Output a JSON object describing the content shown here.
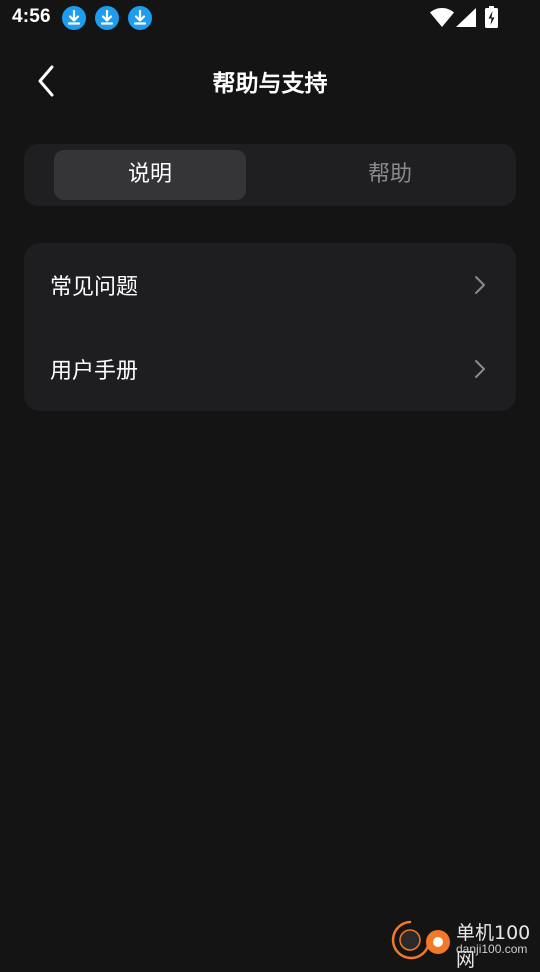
{
  "status_bar": {
    "time": "4:56",
    "notification_icons": [
      "download-icon",
      "download-icon",
      "download-icon"
    ],
    "accent_color": "#1e9cf0"
  },
  "header": {
    "title": "帮助与支持"
  },
  "tabs": [
    {
      "label": "说明",
      "active": true
    },
    {
      "label": "帮助",
      "active": false
    }
  ],
  "list": {
    "items": [
      {
        "label": "常见问题"
      },
      {
        "label": "用户手册"
      }
    ]
  },
  "watermark": {
    "title": "单机100网",
    "url": "danji100.com"
  }
}
